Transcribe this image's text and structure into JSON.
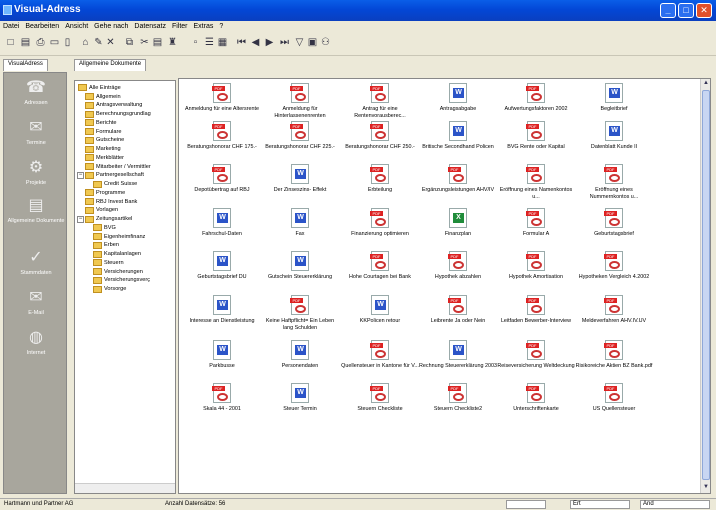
{
  "window": {
    "title": "Visual-Adress"
  },
  "menu": [
    "Datei",
    "Bearbeiten",
    "Ansicht",
    "Gehe nach",
    "Datensatz",
    "Filter",
    "Extras",
    "?"
  ],
  "toolbar_icons": [
    "new-file-icon",
    "save-icon",
    "print-icon",
    "new-folder-icon",
    "open-icon",
    "folder-open-icon",
    "edit-icon",
    "delete-icon",
    "copy-icon",
    "cut-icon",
    "paste-icon",
    "find-icon",
    "small-icons-icon",
    "list-icon",
    "details-icon",
    "first-record-icon",
    "prev-record-icon",
    "next-record-icon",
    "last-record-icon",
    "filter-icon",
    "report-icon",
    "binoculars-icon"
  ],
  "tabs": {
    "left": "VisualAdress",
    "right": "Allgemeine Dokumente"
  },
  "sidebar": [
    {
      "label": "Adressen",
      "icon": "address-book-icon"
    },
    {
      "label": "Termine",
      "icon": "calendar-icon"
    },
    {
      "label": "Projekte",
      "icon": "projects-icon"
    },
    {
      "label": "Allgemeine Dokumente",
      "icon": "documents-icon"
    },
    {
      "label": "Stammdaten",
      "icon": "master-data-icon"
    },
    {
      "label": "E-Mail",
      "icon": "email-icon"
    },
    {
      "label": "Internet",
      "icon": "internet-icon"
    }
  ],
  "tree": {
    "root": "Alle Einträge",
    "nodes": [
      {
        "label": "Allgemein",
        "level": 1
      },
      {
        "label": "Antragsverwaltung",
        "level": 1
      },
      {
        "label": "Berechnungsgrundlag",
        "level": 1
      },
      {
        "label": "Berichte",
        "level": 1
      },
      {
        "label": "Formulare",
        "level": 1
      },
      {
        "label": "Gutscheine",
        "level": 1
      },
      {
        "label": "Marketing",
        "level": 1
      },
      {
        "label": "Merkblätter",
        "level": 1
      },
      {
        "label": "Mitarbeiter / Vermittler",
        "level": 1
      },
      {
        "label": "Partnergesellschaft",
        "level": 1,
        "toggle": "−"
      },
      {
        "label": "Credit Suisse",
        "level": 2
      },
      {
        "label": "Programme",
        "level": 1
      },
      {
        "label": "RBJ Invest Bank",
        "level": 1
      },
      {
        "label": "Vorlagen",
        "level": 1
      },
      {
        "label": "Zeitungsartikel",
        "level": 1,
        "toggle": "−"
      },
      {
        "label": "BVG",
        "level": 2
      },
      {
        "label": "Eigenheimfinanz",
        "level": 2
      },
      {
        "label": "Erben",
        "level": 2
      },
      {
        "label": "Kapitalanlagen",
        "level": 2
      },
      {
        "label": "Steuern",
        "level": 2
      },
      {
        "label": "Versicherungen",
        "level": 2
      },
      {
        "label": "Versicherungsverç",
        "level": 2
      },
      {
        "label": "Vorsorge",
        "level": 2
      }
    ]
  },
  "files": [
    {
      "name": "Anmeldung für eine Altersrente",
      "type": "pdf"
    },
    {
      "name": "Anmeldung für Hinterlassenenrenten",
      "type": "pdf"
    },
    {
      "name": "Antrag für eine Rentenvorausberec...",
      "type": "pdf"
    },
    {
      "name": "Antragsabgabe",
      "type": "doc"
    },
    {
      "name": "Aufwertungsfaktoren 2002",
      "type": "pdf"
    },
    {
      "name": "Begleitbrief",
      "type": "doc"
    },
    {
      "name": "Beratungshonorar CHF 175.-",
      "type": "pdf"
    },
    {
      "name": "Beratungshonorar CHF 225.-",
      "type": "pdf"
    },
    {
      "name": "Beratungshonorar CHF 250.-",
      "type": "pdf"
    },
    {
      "name": "Britische Secondhand Policen",
      "type": "doc"
    },
    {
      "name": "BVG Rente oder Kapital",
      "type": "pdf"
    },
    {
      "name": "Datenblatt Kunde II",
      "type": "doc"
    },
    {
      "name": "Depotübertrag auf RBJ",
      "type": "pdf"
    },
    {
      "name": "Der Zinseszins- Effekt",
      "type": "doc"
    },
    {
      "name": "Erbteilung",
      "type": "pdf"
    },
    {
      "name": "Ergänzungsleistungen AHV/IV",
      "type": "pdf"
    },
    {
      "name": "Eröffnung eines Namenkontos u...",
      "type": "pdf"
    },
    {
      "name": "Eröffnung eines Nummernkontos u...",
      "type": "pdf"
    },
    {
      "name": "Fahrschul-Daten",
      "type": "doc"
    },
    {
      "name": "Fax",
      "type": "doc"
    },
    {
      "name": "Finanzierung optimieren",
      "type": "pdf"
    },
    {
      "name": "Finanzplan",
      "type": "xls"
    },
    {
      "name": "Formular A",
      "type": "pdf"
    },
    {
      "name": "Geburtstagsbrief",
      "type": "pdf"
    },
    {
      "name": "Geburtstagsbrief DU",
      "type": "doc"
    },
    {
      "name": "Gutschein Steuererklärung",
      "type": "doc"
    },
    {
      "name": "Hohe Courtagen bei Bank",
      "type": "pdf"
    },
    {
      "name": "Hypothek abzahlen",
      "type": "pdf"
    },
    {
      "name": "Hypothek Amortisation",
      "type": "pdf"
    },
    {
      "name": "Hypotheken Vergleich 4.2002",
      "type": "pdf"
    },
    {
      "name": "Interesse an Dienstleistung",
      "type": "doc"
    },
    {
      "name": "Keine Haftpflicht= Ein Leben lang Schulden",
      "type": "pdf"
    },
    {
      "name": "KKPolicen retour",
      "type": "doc"
    },
    {
      "name": "Leibrente Ja oder Nein",
      "type": "pdf"
    },
    {
      "name": "Leitfaden Bewerber-Interview",
      "type": "pdf"
    },
    {
      "name": "Meldeverfahren AHV.IV.UV",
      "type": "pdf"
    },
    {
      "name": "Parkbusse",
      "type": "doc"
    },
    {
      "name": "Personendaten",
      "type": "doc"
    },
    {
      "name": "Quellensteuer in Kantone für V...",
      "type": "pdf"
    },
    {
      "name": "Rechnung Steuererklärung 2003",
      "type": "doc"
    },
    {
      "name": "Reiseversicherung Weltdeckung",
      "type": "pdf"
    },
    {
      "name": "Risikoreiche Aktien BZ Bank.pdf",
      "type": "pdf"
    },
    {
      "name": "Skala 44 - 2001",
      "type": "pdf"
    },
    {
      "name": "Steuer Termin",
      "type": "doc"
    },
    {
      "name": "Steuern Checkliste",
      "type": "pdf"
    },
    {
      "name": "Steuern Checkliste2",
      "type": "pdf"
    },
    {
      "name": "Unterschriftenkarte",
      "type": "pdf"
    },
    {
      "name": "US Quellensteuer",
      "type": "pdf"
    }
  ],
  "badges": {
    "pdf": "PDF",
    "doc": "W",
    "xls": "X"
  },
  "status": {
    "company": "Hartmann und Partner AG",
    "records": "Anzahl Datensätze: 56",
    "field1": "Ert",
    "field2": "And"
  }
}
